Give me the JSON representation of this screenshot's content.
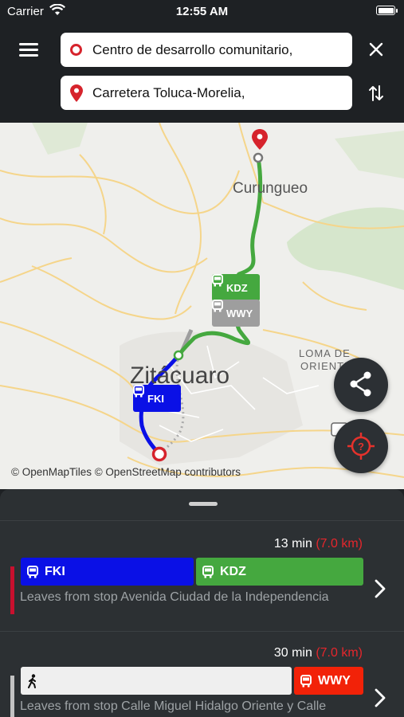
{
  "status_bar": {
    "carrier": "Carrier",
    "time": "12:55 AM"
  },
  "search": {
    "origin": "Centro de desarrollo comunitario,",
    "destination": "Carretera Toluca-Morelia,"
  },
  "map": {
    "labels": {
      "curungueo": "Curungueo",
      "zitacuaro": "Zitácuaro",
      "loma": "LOMA DE",
      "oriente": "ORIENTE"
    },
    "badges": {
      "kdz": "KDZ",
      "wwy": "WWY",
      "fki": "FKI"
    },
    "attribution": "© OpenMapTiles © OpenStreetMap contributors"
  },
  "routes": [
    {
      "duration": "13 min",
      "distance": "(7.0 km)",
      "indicator_color": "#c8102e",
      "segments": [
        {
          "label": "FKI",
          "mode": "bus-icon",
          "color": "#0a10e6"
        },
        {
          "label": "KDZ",
          "mode": "bus-icon",
          "color": "#45a83f"
        }
      ],
      "description": "Leaves from stop Avenida Ciudad de la Independencia"
    },
    {
      "duration": "30 min",
      "distance": "(7.0 km)",
      "indicator_color": "#c2c2c2",
      "segments": [
        {
          "label": "",
          "mode": "walk-icon",
          "color": "#efefef"
        },
        {
          "label": "WWY",
          "mode": "bus-icon",
          "color": "#f22208"
        }
      ],
      "description": "Leaves from stop Calle Miguel Hidalgo Oriente y Calle"
    }
  ],
  "colors": {
    "route_green": "#45a83f",
    "route_blue": "#0a10e6",
    "accent_red": "#d6232c",
    "gray_badge": "#9e9e9e"
  }
}
